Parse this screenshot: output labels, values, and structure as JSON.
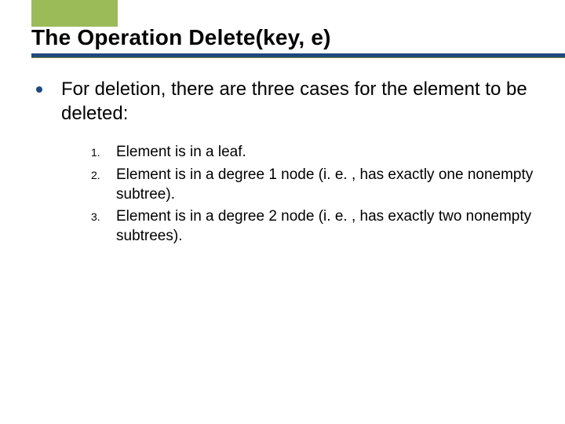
{
  "title": "The Operation Delete(key, e)",
  "body": {
    "intro": "For deletion, there are three cases for the element to be deleted:",
    "items": [
      {
        "num": "1.",
        "text": "Element is in a leaf."
      },
      {
        "num": "2.",
        "text": "Element is in a degree 1 node (i. e. , has exactly one nonempty subtree)."
      },
      {
        "num": "3.",
        "text": "Element is in a degree 2 node (i. e. , has exactly two nonempty subtrees)."
      }
    ]
  }
}
